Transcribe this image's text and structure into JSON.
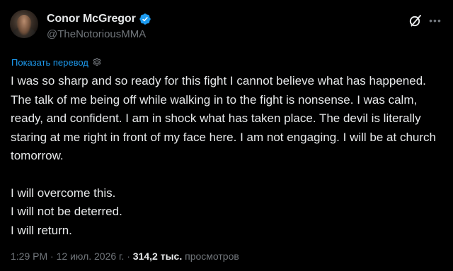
{
  "author": {
    "display_name": "Conor McGregor",
    "handle": "@TheNotoriousMMA",
    "verified": true
  },
  "icons": {
    "verified": "verified-badge-icon",
    "grok": "grok-icon",
    "more": "more-icon",
    "translate_settings": "gear-icon"
  },
  "translate_label": "Показать перевод",
  "tweet": {
    "paragraph1": "I was so sharp and so ready for this fight I cannot believe what has happened. The talk of me being off while walking in to the fight is nonsense. I was calm, ready, and confident. I am in shock what has taken place. The devil is literally staring at me right in front of my face here. I am not engaging. I will be at church tomorrow.",
    "line1": "I will overcome this.",
    "line2": "I will not be deterred.",
    "line3": "I will return."
  },
  "meta": {
    "time": "1:29 PM",
    "date": "12 июл. 2026 г.",
    "separator": "·",
    "views_count": "314,2 тыс.",
    "views_label": "просмотров"
  },
  "colors": {
    "background": "#000000",
    "text": "#e7e9ea",
    "secondary": "#71767b",
    "accent": "#1d9bf0"
  }
}
